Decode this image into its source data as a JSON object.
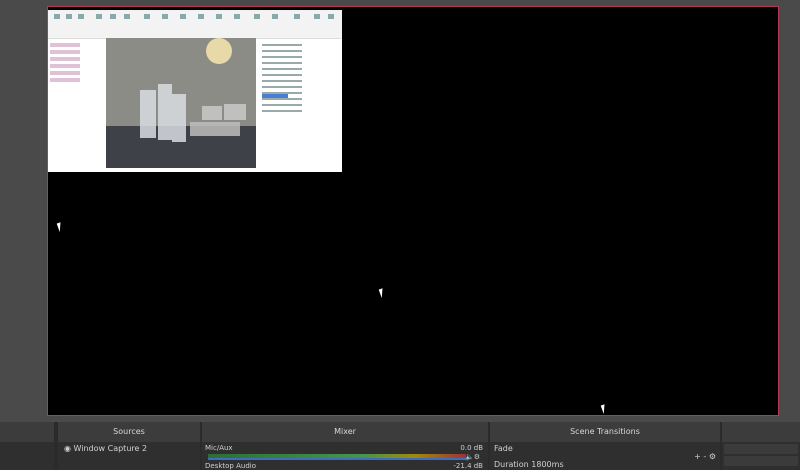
{
  "preview": {
    "canvas_border_color": "#b23a58"
  },
  "dock": {
    "sources_title": "Sources",
    "mixer_title": "Mixer",
    "transitions_title": "Scene Transitions",
    "sources": [
      {
        "name": "Window Capture 2"
      }
    ],
    "mixer": {
      "channels": [
        {
          "name": "Mic/Aux",
          "level": "0.0 dB"
        },
        {
          "name": "Desktop Audio",
          "level": "-21.4 dB"
        }
      ]
    },
    "transitions": {
      "selected": "Fade",
      "duration_label": "Duration 1800ms"
    }
  }
}
